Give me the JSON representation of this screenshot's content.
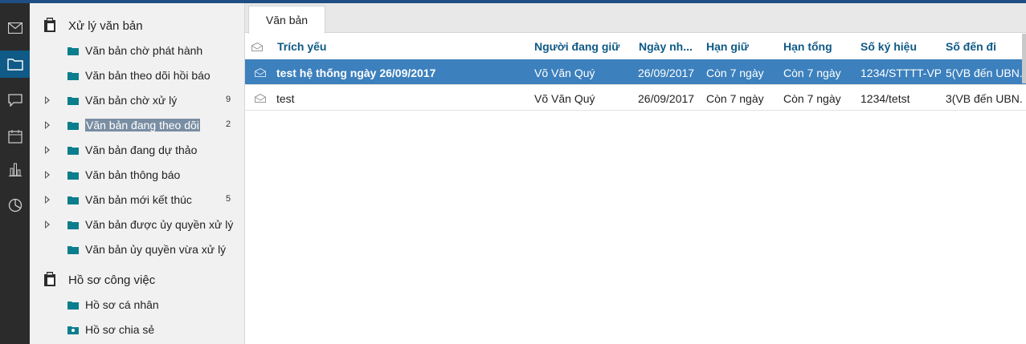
{
  "rail": {
    "items": [
      {
        "name": "mail-icon"
      },
      {
        "name": "folder-icon",
        "active": true
      },
      {
        "name": "chat-icon"
      },
      {
        "name": "calendar-icon"
      },
      {
        "name": "bar-chart-icon"
      },
      {
        "name": "pie-chart-icon"
      }
    ],
    "active_color": "#0f5a86"
  },
  "tree": {
    "group1": {
      "label": "Xử lý văn bản",
      "items": [
        {
          "label": "Văn bản chờ phát hành",
          "count": "",
          "expandable": false
        },
        {
          "label": "Văn bản theo dõi hồi báo",
          "count": "",
          "expandable": false
        },
        {
          "label": "Văn bản chờ xử lý",
          "count": "9",
          "expandable": true
        },
        {
          "label": "Văn bản đang theo dõi",
          "count": "2",
          "expandable": true,
          "selected": true
        },
        {
          "label": "Văn bản đang dự thảo",
          "count": "",
          "expandable": true
        },
        {
          "label": "Văn bản thông báo",
          "count": "",
          "expandable": true
        },
        {
          "label": "Văn bản mới kết thúc",
          "count": "5",
          "expandable": true
        },
        {
          "label": "Văn bản được ủy quyền xử lý",
          "count": "",
          "expandable": true
        },
        {
          "label": "Văn bản ủy quyền vừa xử lý",
          "count": "",
          "expandable": false
        }
      ]
    },
    "group2": {
      "label": "Hồ sơ công việc",
      "items": [
        {
          "label": "Hồ sơ cá nhân",
          "count": "",
          "expandable": false
        },
        {
          "label": "Hồ sơ chia sẻ",
          "count": "",
          "expandable": false
        }
      ]
    }
  },
  "main": {
    "tab": "Văn bản",
    "columns": [
      "Trích yếu",
      "Người đang giữ",
      "Ngày nh...",
      "Hạn giữ",
      "Hạn tổng",
      "Số ký hiệu",
      "Số đến đi"
    ],
    "rows": [
      {
        "subject": "test hệ thống ngày 26/09/2017",
        "holder": "Võ Văn Quý",
        "date": "26/09/2017",
        "hold_deadline": "Còn 7 ngày",
        "total_deadline": "Còn 7 ngày",
        "symbol": "1234/STTTT-VP",
        "in_out": "5(VB đến UBN...",
        "selected": true
      },
      {
        "subject": "test",
        "holder": "Võ Văn Quý",
        "date": "26/09/2017",
        "hold_deadline": "Còn 7 ngày",
        "total_deadline": "Còn 7 ngày",
        "symbol": "1234/tetst",
        "in_out": "3(VB đến UBN...",
        "selected": false
      }
    ]
  },
  "colors": {
    "accent": "#0f5a86",
    "selected_row": "#3c80bd",
    "folder": "#0a7e8c"
  }
}
